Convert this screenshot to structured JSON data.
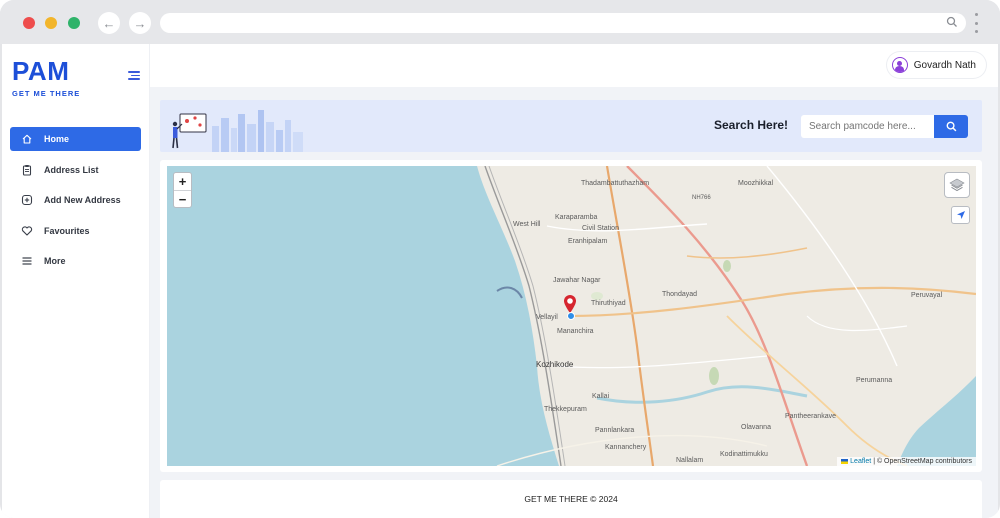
{
  "brand": {
    "name": "PAM",
    "tagline": "GET ME THERE",
    "color": "#1d4fd8"
  },
  "sidebar": {
    "items": [
      {
        "label": "Home",
        "icon": "home-icon",
        "active": true
      },
      {
        "label": "Address List",
        "icon": "clipboard-icon",
        "active": false
      },
      {
        "label": "Add New Address",
        "icon": "add-circle-icon",
        "active": false
      },
      {
        "label": "Favourites",
        "icon": "heart-icon",
        "active": false
      },
      {
        "label": "More",
        "icon": "menu-icon",
        "active": false
      }
    ]
  },
  "header": {
    "user_name": "Govardh Nath"
  },
  "search": {
    "title": "Search Here!",
    "placeholder": "Search pamcode here..."
  },
  "map": {
    "labels": [
      "Thadambattuthazham",
      "Moozhikkal",
      "NH766",
      "West Hill",
      "Karaparamba",
      "Civil Station",
      "Eranhipalam",
      "Jawahar Nagar",
      "Thiruthiyad",
      "Thondayad",
      "Vellayil",
      "Mananchira",
      "Kozhikode",
      "Kallai",
      "Thekkepuram",
      "Pannlankara",
      "Kannanchery",
      "Nallalam",
      "Kodinattimukku",
      "Olavanna",
      "Pantheerankave",
      "Perumanna",
      "Peruvayal"
    ],
    "zoom_in": "+",
    "zoom_out": "−",
    "attribution_link": "Leaflet",
    "attribution_text": "| © OpenStreetMap contributors"
  },
  "colors": {
    "accent": "#2e6ae6",
    "sea": "#aad3df",
    "land": "#eeebe4"
  },
  "footer": {
    "text": "GET ME THERE © 2024"
  }
}
